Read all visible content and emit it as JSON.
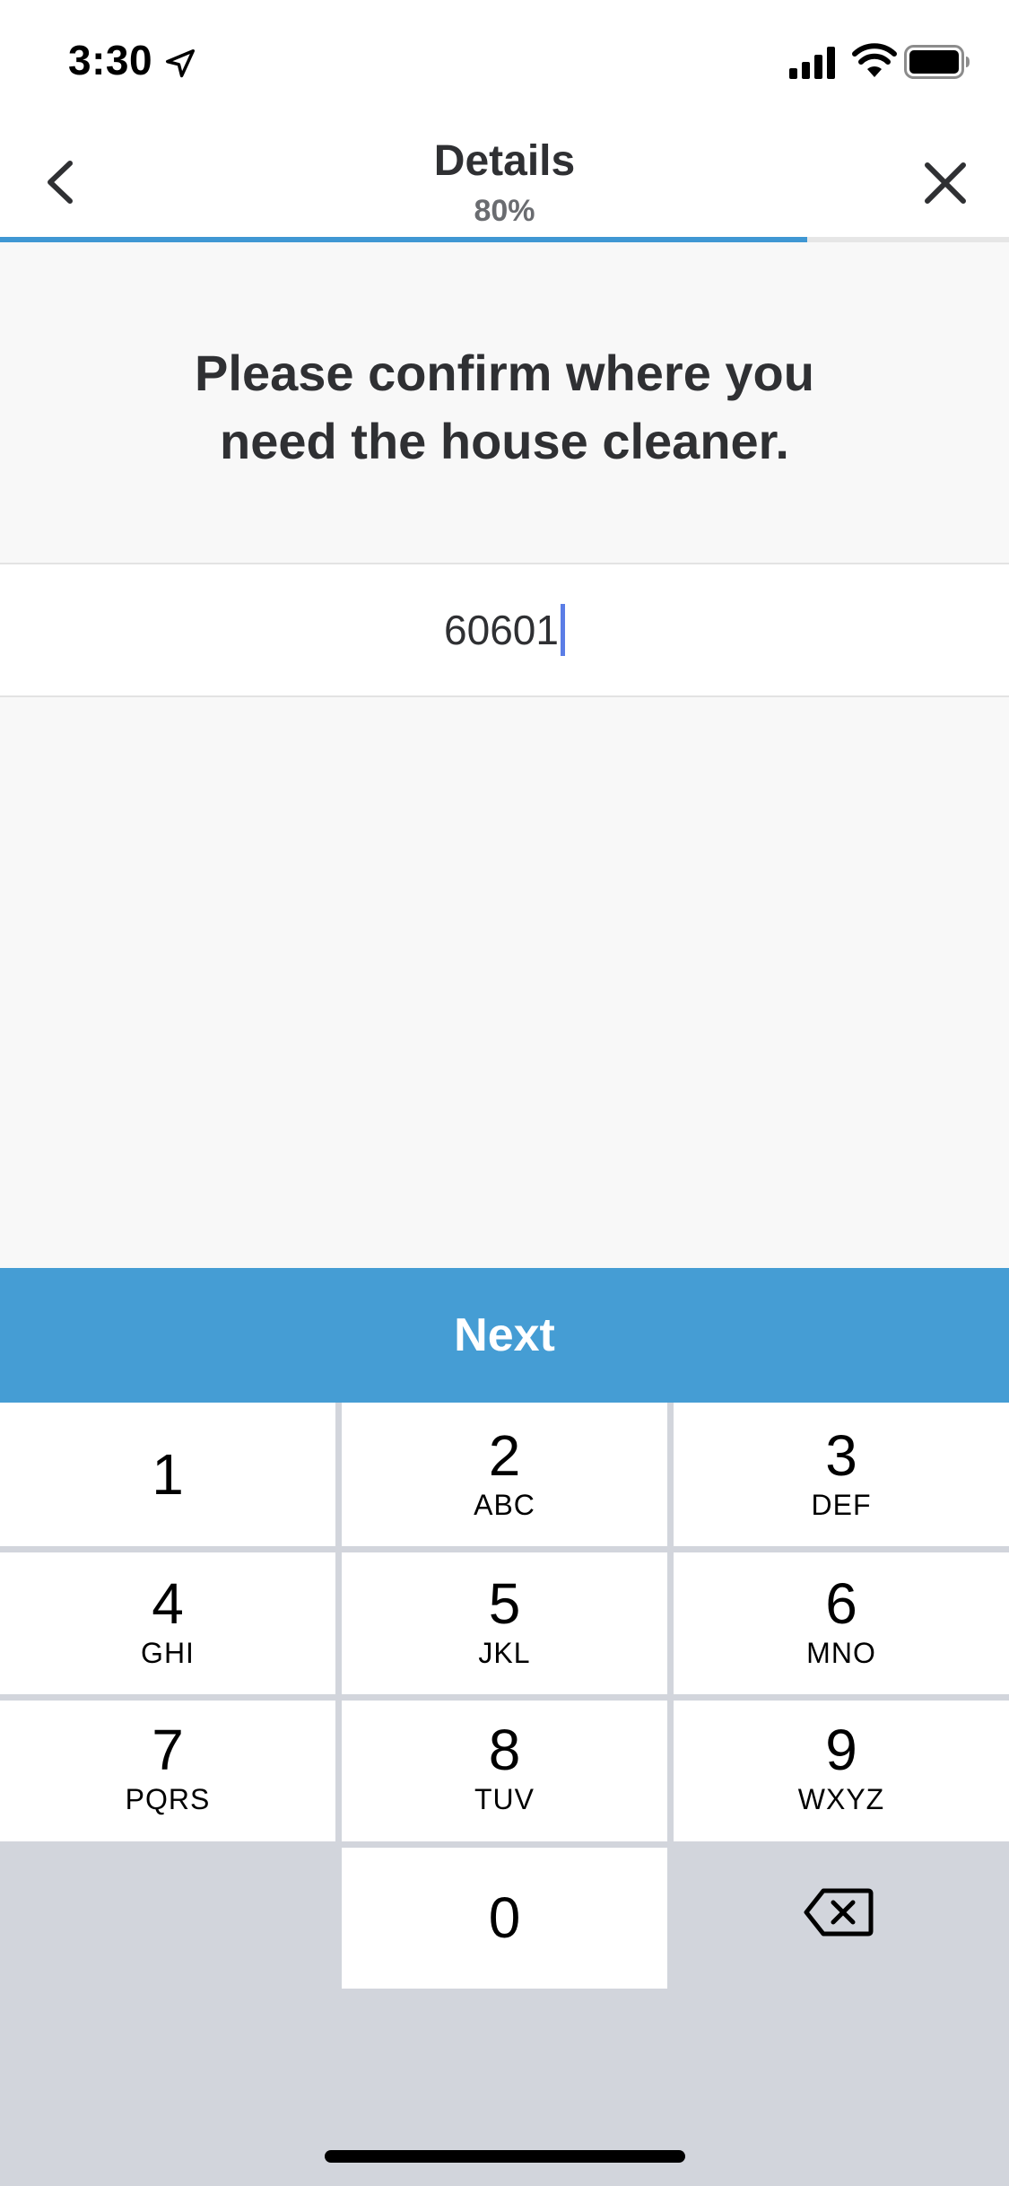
{
  "status_bar": {
    "time": "3:30",
    "icons": [
      "location-arrow-icon",
      "cellular-signal-icon",
      "wifi-icon",
      "battery-icon"
    ]
  },
  "header": {
    "title": "Details",
    "progress_text": "80%",
    "progress_value": 0.8,
    "back_icon": "chevron-left-icon",
    "close_icon": "close-icon",
    "accent_color": "#3f97d3"
  },
  "question": {
    "line1": "Please confirm where you",
    "line2": "need the house cleaner."
  },
  "zip_input": {
    "value": "60601"
  },
  "next_button": {
    "label": "Next",
    "color": "#459dd4"
  },
  "keyboard": {
    "keys": [
      {
        "num": "1",
        "letters": ""
      },
      {
        "num": "2",
        "letters": "ABC"
      },
      {
        "num": "3",
        "letters": "DEF"
      },
      {
        "num": "4",
        "letters": "GHI"
      },
      {
        "num": "5",
        "letters": "JKL"
      },
      {
        "num": "6",
        "letters": "MNO"
      },
      {
        "num": "7",
        "letters": "PQRS"
      },
      {
        "num": "8",
        "letters": "TUV"
      },
      {
        "num": "9",
        "letters": "WXYZ"
      },
      {
        "num": "0",
        "letters": ""
      }
    ],
    "backspace_icon": "backspace-icon"
  }
}
